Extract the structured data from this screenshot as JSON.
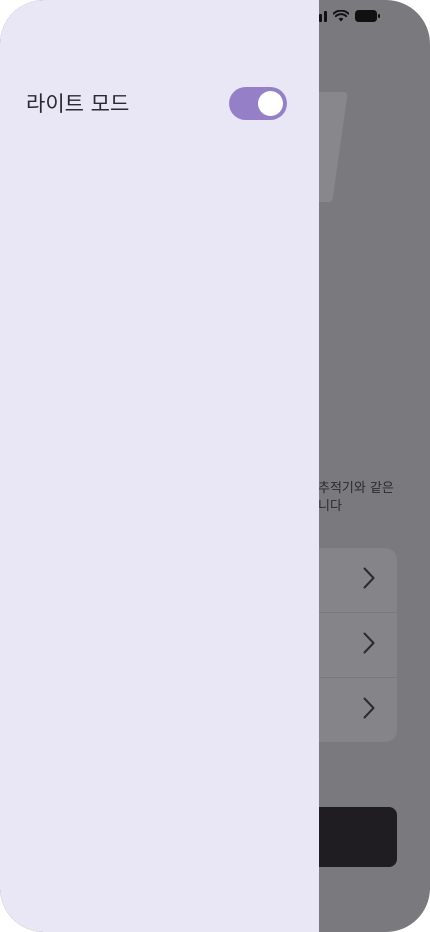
{
  "drawer": {
    "light_mode_label": "라이트 모드",
    "light_mode_enabled": true
  },
  "background": {
    "description_line1": "추적기와 같은",
    "description_line2": "니다",
    "list_rows": 3
  },
  "icons": {
    "signal": "cellular-signal-icon",
    "wifi": "wifi-icon",
    "battery": "battery-icon",
    "chevron": "chevron-right-icon"
  },
  "colors": {
    "drawer_bg": "#e9e7f5",
    "toggle_on": "#9580c8",
    "overlay": "#7a797e"
  }
}
